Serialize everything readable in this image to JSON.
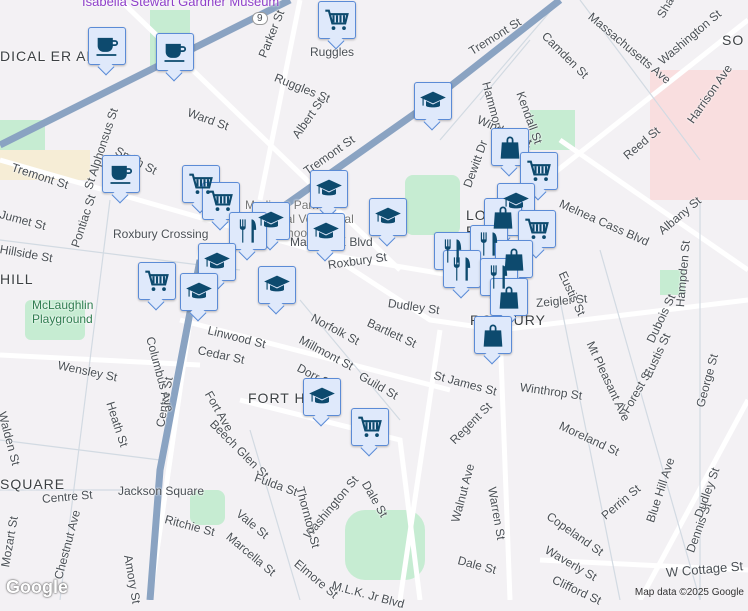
{
  "colors": {
    "marker_fill": "#dfe9fb",
    "marker_border": "#5b8bd6",
    "icon": "#0d4a6e",
    "park": "#c6ecd2",
    "highway": "#8aa3c2",
    "road": "#ffffff"
  },
  "labels": {
    "museum": "Isabella Stewart Gardner Museum",
    "medical": "DICAL ER AREA",
    "ruggles": "Ruggles",
    "ruggles_st": "Ruggles St",
    "parker": "Parker St",
    "ward": "Ward St",
    "albert": "Albert St",
    "tremont_w": "Tremont St",
    "tremont_c": "Tremont St",
    "tremont_e": "Tremont St",
    "alphonsus": "St Alphonsus St",
    "smith": "Smith St",
    "pontiac": "Pontiac St",
    "roxbury_crossing": "Roxbury Crossing",
    "school": "Madison Park Technical Vocational High School",
    "malcolmx": "Malcolm X Blvd",
    "roxbury_st": "Roxbury St",
    "hillside": "Hillside St",
    "jumet": "Jumet St",
    "hill": "HILL",
    "mclaughlin": "McLaughlin Playground",
    "cedar": "Cedar St",
    "wensley": "Wensley St",
    "linwood": "Linwood St",
    "norfolk": "Norfolk St",
    "millmont": "Millmont St",
    "dorr": "Dorr St",
    "bartlett": "Bartlett St",
    "dudley": "Dudley St",
    "guild": "Guild St",
    "fort_hill": "FORT HILL",
    "fort_ave": "Fort Ave",
    "beech_glen": "Beech Glen St",
    "centre_st": "Centre St",
    "columbus": "Columbus Ave",
    "heath": "Heath St",
    "walden": "Walden St",
    "square": "SQUARE",
    "centre_st2": "Centre St",
    "jackson": "Jackson Square",
    "st_james": "St James St",
    "winthrop": "Winthrop St",
    "regent": "Regent St",
    "warren": "Warren St",
    "moreland": "Moreland St",
    "walnut": "Walnut Ave",
    "washington_s": "Washington St",
    "thornton": "Thornton St",
    "fulda": "Fulda St",
    "dale": "Dale St",
    "vale": "Vale St",
    "marcella": "Marcella St",
    "ritchie": "Ritchie St",
    "chestnut": "Chestnut Ave",
    "mozart": "Mozart St",
    "amory": "Amory St",
    "elmore": "Elmore St",
    "mlk": "M.L.K. Jr Blvd",
    "dale2": "Dale St",
    "copeland": "Copeland St",
    "waverly": "Waverly St",
    "clifford": "Clifford St",
    "perrin": "Perrin St",
    "w_cottage": "W Cottage St",
    "blue_hill": "Blue Hill Ave",
    "dennis": "Dennis St",
    "dudley_st_e": "Dudley St",
    "george": "George St",
    "forest": "Forest St",
    "eustis_s": "Eustis St",
    "mt_pleasant": "Mt Pleasant Ave",
    "dubois": "Dubois St",
    "zeigler": "Zeigler St",
    "hampden": "Hampden St",
    "eustis_n": "Eustis St",
    "albany": "Albany St",
    "melnea": "Melnea Cass Blvd",
    "reed": "Reed St",
    "harrison": "Harrison Ave",
    "mass_ave": "Massachusetts Ave",
    "washington_n": "Washington St",
    "camden": "Camden St",
    "hammond": "Hammond St",
    "kendall": "Kendall St",
    "windsor": "Windsor St",
    "dewitt": "Dewitt Dr",
    "lower_roxbury": "LOWER ROXBURY",
    "roxbury": "ROXBURY",
    "south_end": "SO WAS",
    "shaw": "Shaw",
    "route9": "9"
  },
  "footer": {
    "logo": "Google",
    "attribution": "Map data ©2025 Google"
  }
}
